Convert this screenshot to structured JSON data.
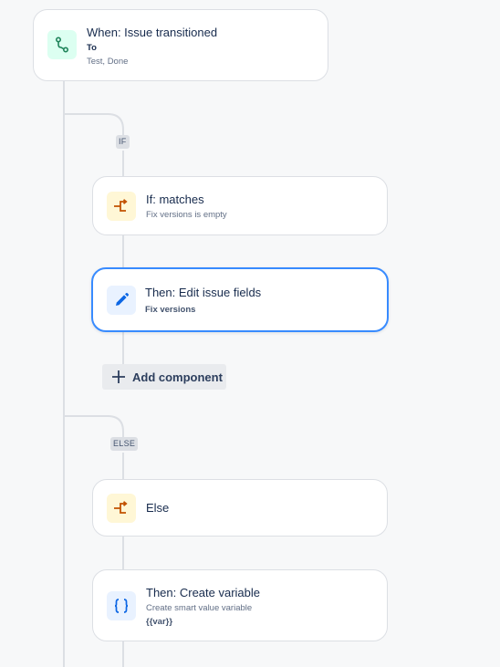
{
  "trigger": {
    "title": "When: Issue transitioned",
    "detail_label": "To",
    "detail_value": "Test, Done",
    "icon": "branch-transition-icon",
    "accent": "#1f845a"
  },
  "if_branch": {
    "tag": "IF",
    "condition": {
      "title": "If: matches",
      "subtitle": "Fix versions is empty",
      "icon": "condition-branch-icon"
    },
    "action": {
      "title": "Then: Edit issue fields",
      "subtitle": "Fix versions",
      "icon": "pencil-icon"
    },
    "add_component_label": "Add component"
  },
  "else_branch": {
    "tag": "ELSE",
    "condition": {
      "title": "Else",
      "icon": "condition-branch-icon"
    },
    "action": {
      "title": "Then: Create variable",
      "subtitle": "Create smart value variable",
      "detail": "{{var}}",
      "icon": "braces-icon"
    }
  },
  "colors": {
    "selected_border": "#388bff",
    "condition_icon": "#c25100",
    "action_icon": "#0c66e4",
    "trigger_icon": "#1f845a",
    "connector": "#dcdfe4"
  }
}
